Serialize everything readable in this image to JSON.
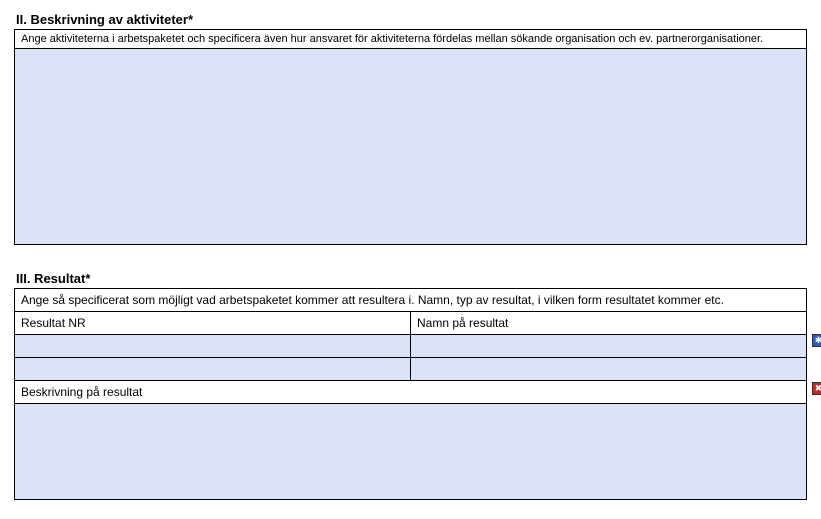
{
  "section2": {
    "heading": "II. Beskrivning av aktiviteter*",
    "instruction": "Ange aktiviteterna i arbetspaketet och specificera även hur ansvaret för aktiviteterna fördelas mellan sökande organisation och ev. partnerorganisationer.",
    "value": ""
  },
  "section3": {
    "heading": "III. Resultat*",
    "instruction": "Ange så specificerat som möjligt vad arbetspaketet kommer att resultera i. Namn, typ av resultat, i vilken form resultatet kommer etc.",
    "col_nr": "Resultat NR",
    "col_name": "Namn på resultat",
    "rows": [
      {
        "nr": "",
        "name": ""
      },
      {
        "nr": "",
        "name": ""
      }
    ],
    "desc_heading": "Beskrivning på resultat",
    "desc_value": "",
    "icons": {
      "add": "✱",
      "delete": "✖"
    }
  }
}
